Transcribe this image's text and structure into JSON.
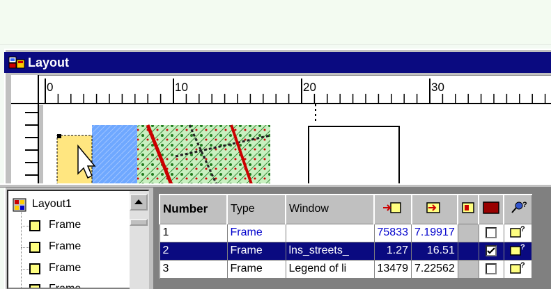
{
  "window": {
    "title": "Layout"
  },
  "ruler": {
    "ticks": [
      "0",
      "10",
      "20",
      "30"
    ]
  },
  "tree": {
    "root": "Layout1",
    "items": [
      "Frame",
      "Frame",
      "Frame",
      "Frame"
    ]
  },
  "table": {
    "headers": [
      "Number",
      "Type",
      "Window"
    ],
    "icon_headers": [
      "frame-left-arrow-icon",
      "frame-right-arrow-icon",
      "frame-border-icon",
      "fill-color-icon",
      "pin-help-icon"
    ],
    "rows": [
      {
        "number": "1",
        "type": "Frame",
        "window": "",
        "left": "75833",
        "right": "7.19917",
        "checked": false,
        "selected": false
      },
      {
        "number": "2",
        "type": "Frame",
        "window": "lns_streets_",
        "left": "1.27",
        "right": "16.51",
        "checked": true,
        "selected": true
      },
      {
        "number": "3",
        "type": "Frame",
        "window": "Legend of li",
        "left": "13479",
        "right": "7.22562",
        "checked": false,
        "selected": false
      }
    ]
  },
  "colors": {
    "titlebar": "#0a0a80",
    "selection": "#0a0a80",
    "frame_fill": "#ffff80",
    "link_blue": "#0000cc"
  }
}
